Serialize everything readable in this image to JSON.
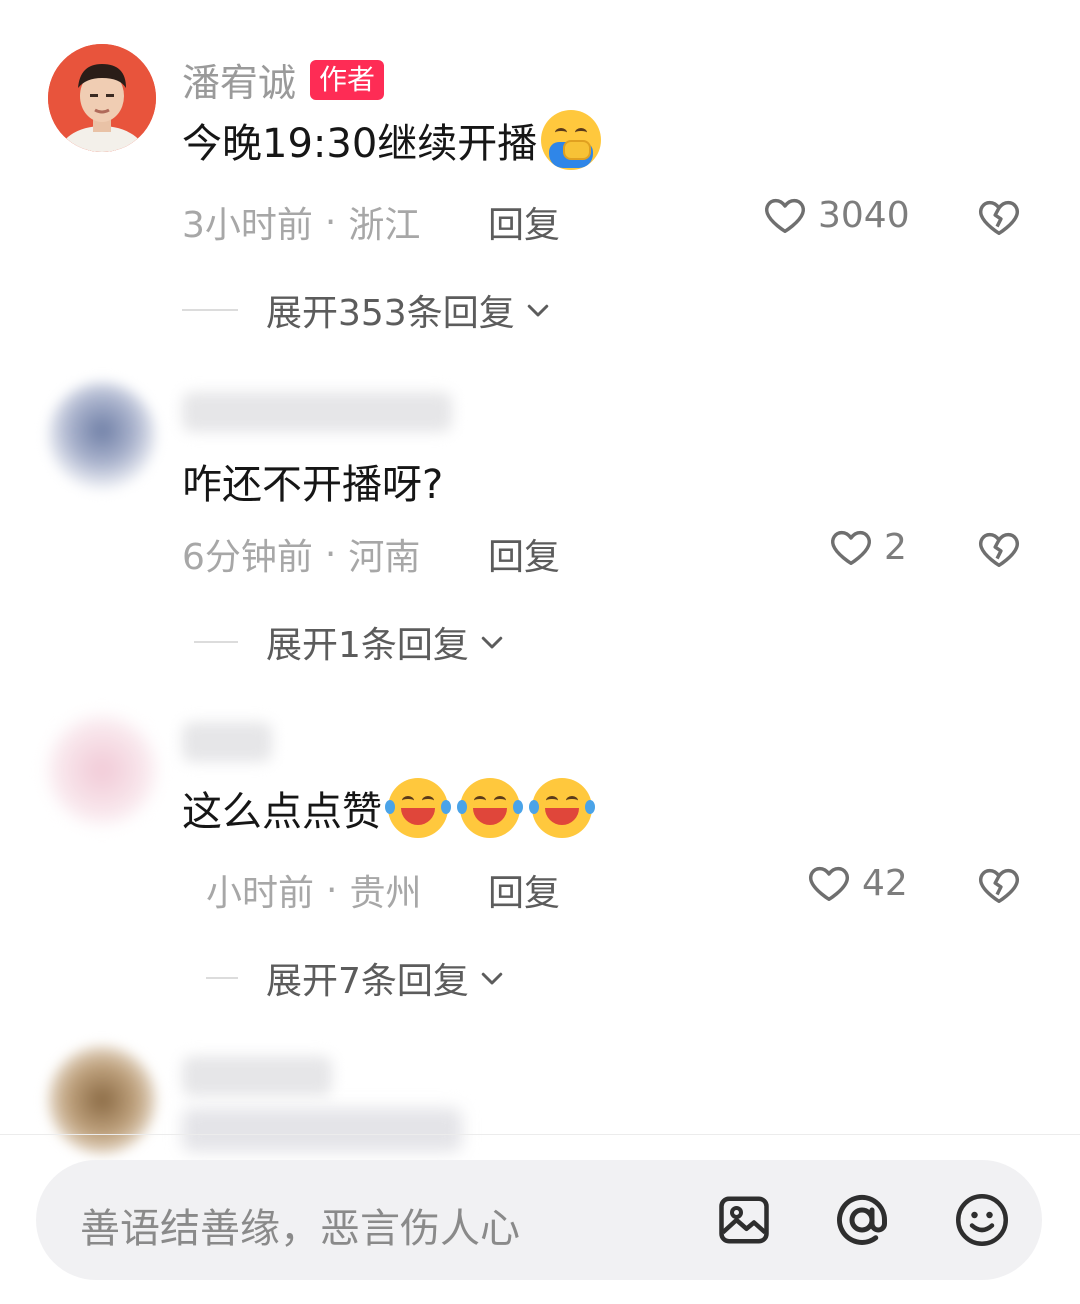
{
  "comments": [
    {
      "username": "潘宥诚",
      "badge": "作者",
      "text": "今晚19:30继续开播",
      "time": "3小时前",
      "location": "浙江",
      "reply_label": "回复",
      "likes": "3040",
      "expand_label": "展开353条回复"
    },
    {
      "username": "",
      "text": "咋还不开播呀?",
      "time": "6分钟前",
      "location": "河南",
      "reply_label": "回复",
      "likes": "2",
      "expand_label": "展开1条回复"
    },
    {
      "username": "",
      "text": "这么点点赞",
      "time": "小时前",
      "location": "贵州",
      "reply_label": "回复",
      "likes": "42",
      "expand_label": "展开7条回复"
    }
  ],
  "input": {
    "placeholder": "善语结善缘，恶言伤人心"
  },
  "icons": {
    "image": "image-icon",
    "mention": "at-icon",
    "emoji": "emoji-icon",
    "like": "heart-icon",
    "dislike": "broken-heart-icon",
    "expand": "chevron-down-icon"
  },
  "colors": {
    "badge": "#fe2c55",
    "meta_text": "#a7a7a7"
  }
}
